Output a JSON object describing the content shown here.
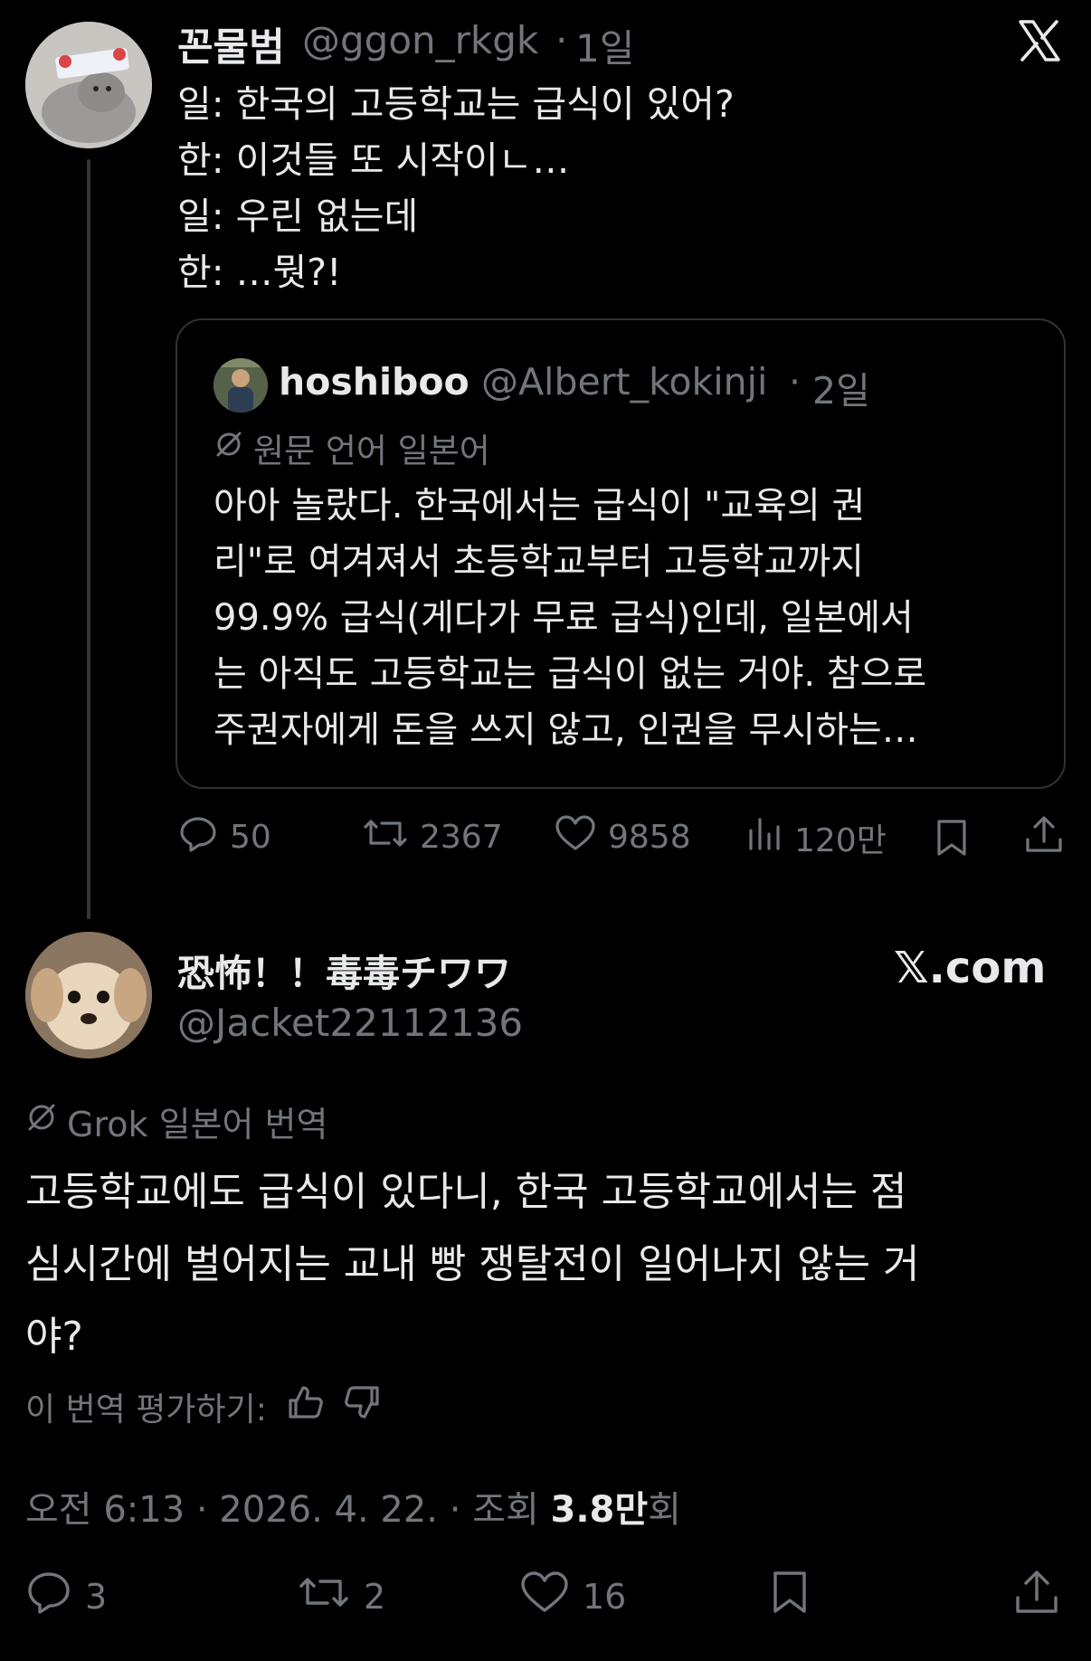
{
  "tweet1": {
    "display_name": "꼰물범",
    "handle": "@ggon_rkgk",
    "separator": "·",
    "time": "1일",
    "lines": [
      "일: 한국의 고등학교는 급식이 있어?",
      "한: 이것들 또 시작이ㄴ…",
      "일: 우린 없는데",
      "한: …뭣?!"
    ],
    "quote": {
      "display_name": "hoshiboo",
      "handle": "@Albert_kokinji",
      "separator": "·",
      "time": "2일",
      "translation_note": "원문 언어 일본어",
      "lines": [
        "아아 놀랐다. 한국에서는 급식이 \"교육의 권",
        "리\"로 여겨져서 초등학교부터 고등학교까지",
        "99.9% 급식(게다가 무료 급식)인데, 일본에서",
        "는 아직도 고등학교는 급식이 없는 거야. 참으로",
        "주권자에게 돈을 쓰지 않고, 인권을 무시하는…"
      ]
    },
    "actions": {
      "replies": "50",
      "reposts": "2367",
      "likes": "9858",
      "views": "120만"
    }
  },
  "tweet2": {
    "display_name": "恐怖！！毒毒チワワ",
    "handle": "@Jacket22112136",
    "brand": "𝕏.com",
    "translation_note": "Grok 일본어 번역",
    "lines": [
      "고등학교에도 급식이 있다니, 한국 고등학교에서는 점",
      "심시간에 벌어지는 교내 빵 쟁탈전이 일어나지 않는 거",
      "야?"
    ],
    "rate_label": "이 번역 평가하기:",
    "meta": {
      "time": "오전 6:13",
      "date": "2026. 4. 22.",
      "views_label": "조회",
      "views_value": "3.8만",
      "views_suffix": "회",
      "separator": "·"
    },
    "actions": {
      "replies": "3",
      "reposts": "2",
      "likes": "16"
    }
  },
  "icons": {
    "close": "x-logo-icon",
    "reply": "reply-icon",
    "repost": "repost-icon",
    "like": "heart-icon",
    "views": "views-icon",
    "bookmark": "bookmark-icon",
    "share": "share-icon",
    "translate": "translate-icon",
    "thumbs_up": "thumbs-up-icon",
    "thumbs_down": "thumbs-down-icon"
  },
  "colors": {
    "background": "#000000",
    "text": "#e7e9ea",
    "muted": "#71767b",
    "border": "#2f3336"
  }
}
